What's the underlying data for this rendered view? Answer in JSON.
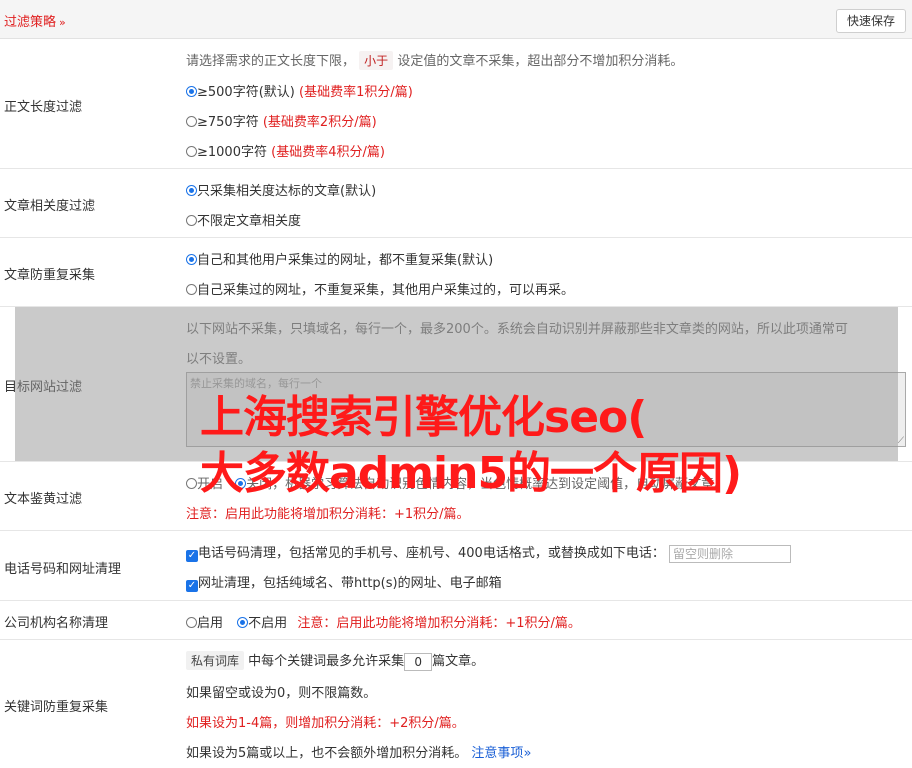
{
  "header": {
    "title": "过滤策略",
    "chevron": "»",
    "save_label": "快速保存"
  },
  "length_filter": {
    "label": "正文长度过滤",
    "desc_pre": "请选择需求的正文长度下限，",
    "desc_tag": "小于",
    "desc_post": "设定值的文章不采集，超出部分不增加积分消耗。",
    "options": [
      {
        "text": "≥500字符(默认)",
        "note": "(基础费率1积分/篇)",
        "selected": true
      },
      {
        "text": "≥750字符",
        "note": "(基础费率2积分/篇)",
        "selected": false
      },
      {
        "text": "≥1000字符",
        "note": "(基础费率4积分/篇)",
        "selected": false
      }
    ]
  },
  "relevance": {
    "label": "文章相关度过滤",
    "options": [
      {
        "text": "只采集相关度达标的文章(默认)",
        "selected": true
      },
      {
        "text": "不限定文章相关度",
        "selected": false
      }
    ]
  },
  "dedupe": {
    "label": "文章防重复采集",
    "options": [
      {
        "text": "自己和其他用户采集过的网址，都不重复采集(默认)",
        "selected": true
      },
      {
        "text": "自己采集过的网址，不重复采集，其他用户采集过的，可以再采。",
        "selected": false
      }
    ]
  },
  "target_sites": {
    "label": "目标网站过滤",
    "desc_line1": "以下网站不采集，只填域名，每行一个，最多200个。系统会自动识别并屏蔽那些非文章类的网站，所以此项通常可",
    "desc_line2": "以不设置。",
    "placeholder": "禁止采集的域名，每行一个"
  },
  "porn_filter": {
    "label": "文本鉴黄过滤",
    "opt_on": "开启",
    "opt_off": "关闭",
    "desc": "，机器学习算法自动识别色情内容，当色情概率达到设定阈值，自动屏蔽文章。",
    "note": "注意：启用此功能将增加积分消耗：+1积分/篇。"
  },
  "phone_url": {
    "label": "电话号码和网址清理",
    "phone_text": "电话号码清理，包括常见的手机号、座机号、400电话格式，或替换成如下电话：",
    "phone_placeholder": "留空则删除",
    "url_text": "网址清理，包括纯域名、带http(s)的网址、电子邮箱"
  },
  "org_name": {
    "label": "公司机构名称清理",
    "opt_on": "启用",
    "opt_off": "不启用",
    "note": "注意：启用此功能将增加积分消耗：+1积分/篇。"
  },
  "keyword_dedupe": {
    "label": "关键词防重复采集",
    "tag": "私有词库",
    "text_pre": "中每个关键词最多允许采集",
    "value": "0",
    "text_post": "篇文章。",
    "line2": "如果留空或设为0，则不限篇数。",
    "line3": "如果设为1-4篇，则增加积分消耗：+2积分/篇。",
    "line4": "如果设为5篇或以上，也不会额外增加积分消耗。",
    "link": "注意事项",
    "link_chevron": "»"
  },
  "watermark": {
    "line1": "上海搜索引擎优化seo(",
    "line2": "大多数admin5的一个原因)"
  }
}
